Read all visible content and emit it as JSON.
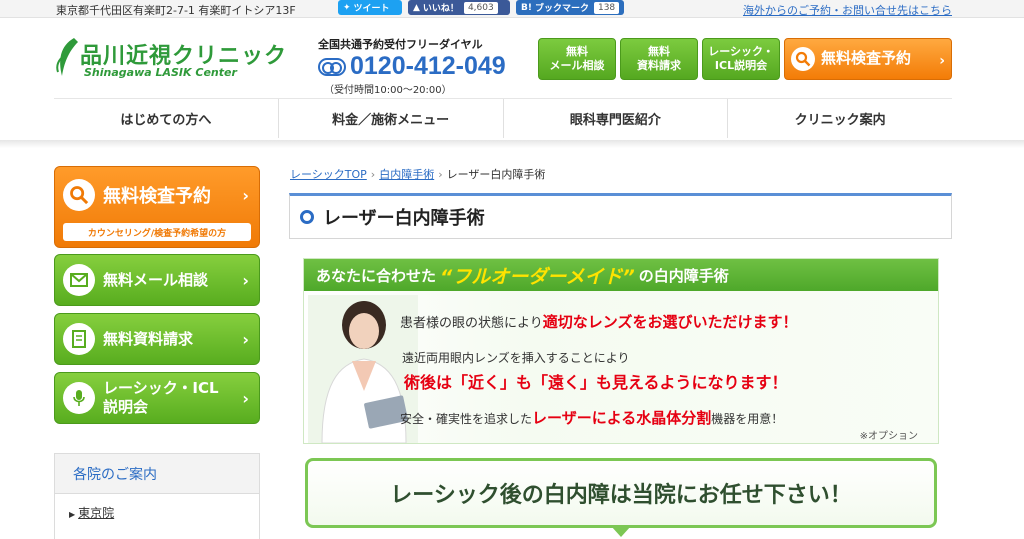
{
  "topbar": {
    "address": "東京都千代田区有楽町2-7-1 有楽町イトシア13F",
    "tweet_label": "ツイート",
    "like_label": "いいね！",
    "like_count": "4,603",
    "bookmark_label": "ブックマーク",
    "bookmark_count": "138",
    "overseas_link": "海外からのご予約・お問い合せ先はこちら"
  },
  "header": {
    "logo_text": "品川近視クリニック",
    "logo_sub": "Shinagawa LASIK Center",
    "phone_lead": "全国共通予約受付フリーダイヤル",
    "phone_number": "0120-412-049",
    "phone_hours": "（受付時間10:00〜20:00）",
    "buttons": [
      {
        "label": "無料\nメール相談"
      },
      {
        "label": "無料\n資料請求"
      },
      {
        "label": "レーシック・\nICL説明会"
      }
    ],
    "reserve_label": "無料検査予約"
  },
  "nav": {
    "items": [
      "はじめての方へ",
      "料金／施術メニュー",
      "眼科専門医紹介",
      "クリニック案内"
    ]
  },
  "sidebar": {
    "reserve": {
      "label": "無料検査予約",
      "sub": "カウンセリング/検査予約希望の方"
    },
    "mail": "無料メール相談",
    "docs": "無料資料請求",
    "seminar": "レーシック・ICL\n説明会",
    "branch_title": "各院のご案内",
    "branch_item": "東京院"
  },
  "main": {
    "breadcrumb": [
      "レーシックTOP",
      "白内障手術",
      "レーザー白内障手術"
    ],
    "page_title": "レーザー白内障手術",
    "banner": {
      "head_pre": "あなたに合わせた",
      "head_em": "“フルオーダーメイド”",
      "head_post": "の白内障手術",
      "line1_pre": "患者様の眼の状態により",
      "line1_red": "適切なレンズをお選びいただけます！",
      "line2": "遠近両用眼内レンズを挿入することにより",
      "line3": "術後は「近く」も「遠く」も見えるようになります！",
      "line4_pre": "安全・確実性を追求した",
      "line4_red": "レーザーによる水晶体分割",
      "line4_post": "機器を用意！",
      "note": "※オプション"
    },
    "cta": "レーシック後の白内障は当院にお任せ下さい！"
  }
}
